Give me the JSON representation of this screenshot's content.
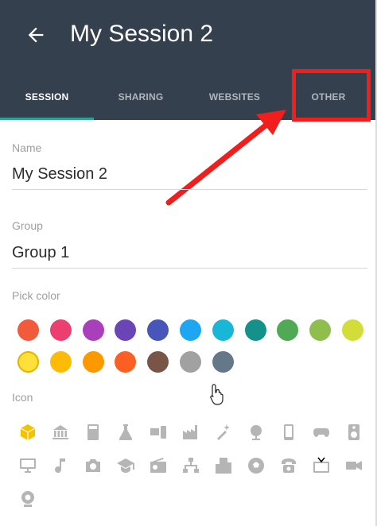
{
  "header": {
    "title": "My Session 2",
    "background": "#34404d"
  },
  "tabs": [
    {
      "label": "SESSION",
      "active": true
    },
    {
      "label": "SHARING",
      "active": false
    },
    {
      "label": "WEBSITES",
      "active": false
    },
    {
      "label": "OTHER",
      "active": false
    }
  ],
  "form": {
    "name": {
      "label": "Name",
      "value": "My Session 2"
    },
    "group": {
      "label": "Group",
      "value": "Group 1"
    },
    "pick_color_label": "Pick color",
    "icon_label": "Icon"
  },
  "colors": [
    "#f15a3b",
    "#ec3f6f",
    "#a93fbb",
    "#6b45b6",
    "#4756b8",
    "#1ea6f2",
    "#19b6d8",
    "#13918a",
    "#4fa955",
    "#8fbe4d",
    "#d3dd3a",
    "#fde03a",
    "#fdbb08",
    "#fd9900",
    "#fb5f24",
    "#795548",
    "#a1a1a1",
    "#65788a"
  ],
  "selected_color": "#fde03a",
  "icons": [
    "cube-icon",
    "bank-icon",
    "calculator-icon",
    "flask-icon",
    "devices-icon",
    "factory-icon",
    "magic-wand-icon",
    "globe-icon",
    "smartphone-icon",
    "gamepad-icon",
    "speaker-icon",
    "monitor-icon",
    "music-note-icon",
    "camera-icon",
    "graduation-cap-icon",
    "radio-icon",
    "hierarchy-icon",
    "building-icon",
    "soccer-ball-icon",
    "phone-icon",
    "tv-icon",
    "video-camera-icon",
    "webcam-icon"
  ],
  "accent_colors": {
    "highlight": "#f21d1d",
    "tab_indicator": "#26a69a",
    "selected_icon": "#f7c100"
  }
}
